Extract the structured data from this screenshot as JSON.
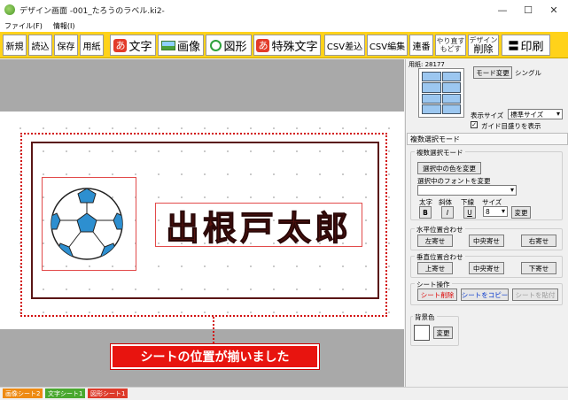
{
  "window": {
    "title": "デザイン画面 -001_たろうのラベル.ki2-",
    "controls": {
      "minimize": "—",
      "maximize": "☐",
      "close": "✕"
    }
  },
  "menu": [
    "ファイル(F)",
    "情報(I)"
  ],
  "toolbar": {
    "new": "新規",
    "open": "読込",
    "save": "保存",
    "paper": "用紙",
    "text_icon": "あ",
    "text": "文字",
    "image": "画像",
    "shape": "図形",
    "special_icon": "あ",
    "special": "特殊文字",
    "csv_insert": "CSV差込",
    "csv_edit": "CSV編集",
    "serial": "連番",
    "undo_top": "やり直す",
    "undo_bottom": "もどす",
    "design_top": "デザイン",
    "design_bottom": "削除",
    "print_icon": "〓",
    "print": "印刷"
  },
  "canvas": {
    "label_text": "出根戸太郎",
    "callout": "シートの位置が揃いました"
  },
  "side": {
    "paper_label": "用紙: 28177",
    "mode_change": "モード変更",
    "mode_value": "シングル",
    "display_size_label": "表示サイズ",
    "display_size_value": "標準サイズ",
    "guide_check": "✓",
    "guide_label": "ガイド目盛りを表示",
    "panel_title": "複数選択モード",
    "multi_group": "複数選択モード",
    "change_color": "選択中の色を変更",
    "change_font_label": "選択中のフォントを変更",
    "font_value": "",
    "bold_label": "太字",
    "italic_label": "斜体",
    "underline_label": "下線",
    "size_label": "サイズ",
    "bold_btn": "B",
    "italic_btn": "I",
    "underline_btn": "U",
    "size_value": "8",
    "size_change": "変更",
    "h_align_group": "水平位置合わせ",
    "align_left": "左寄せ",
    "align_hcenter": "中央寄せ",
    "align_right": "右寄せ",
    "v_align_group": "垂直位置合わせ",
    "align_top": "上寄せ",
    "align_vcenter": "中央寄せ",
    "align_bottom": "下寄せ",
    "sheet_group": "シート操作",
    "sheet_delete": "シート削除",
    "sheet_copy": "シートをコピー",
    "sheet_paste": "シートを貼付",
    "bg_color_label": "背景色",
    "bg_change": "変更"
  },
  "status_tabs": [
    {
      "label": "画像シート2",
      "color": "#ee8a12"
    },
    {
      "label": "文字シート1",
      "color": "#49a82f"
    },
    {
      "label": "図形シート1",
      "color": "#dd3a2a"
    }
  ],
  "colors": {
    "toolbar": "#ffd21a",
    "accent_red": "#e8140f",
    "label_border": "#5a1515"
  }
}
